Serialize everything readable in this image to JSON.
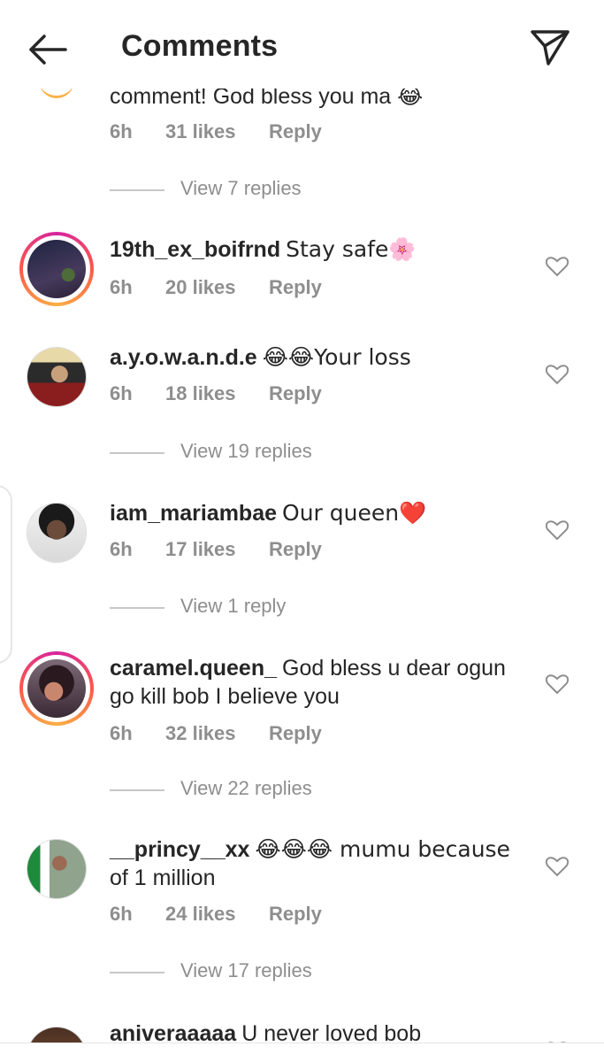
{
  "header": {
    "title": "Comments",
    "back_icon": "arrow-left-icon",
    "send_icon": "paper-plane-icon"
  },
  "top_partial": {
    "text": "comment! God bless you ma 😂",
    "time": "6h",
    "likes": "31 likes",
    "reply": "Reply",
    "view_replies": "View 7 replies"
  },
  "comments": [
    {
      "username": "19th_ex_boifrnd",
      "text": "Stay safe🌸",
      "time": "6h",
      "likes": "20 likes",
      "reply": "Reply",
      "story_ring": true
    },
    {
      "username": "a.y.o.w.a.n.d.e",
      "text": "😂😂Your loss",
      "time": "6h",
      "likes": "18 likes",
      "reply": "Reply",
      "view_replies": "View 19 replies"
    },
    {
      "username": "iam_mariambae",
      "text": "Our queen❤️",
      "time": "6h",
      "likes": "17 likes",
      "reply": "Reply",
      "view_replies": "View 1 reply"
    },
    {
      "username": "caramel.queen_",
      "text": "God bless u dear ogun",
      "text_line2": "go kill bob I believe you",
      "time": "6h",
      "likes": "32 likes",
      "reply": "Reply",
      "view_replies": "View 22 replies",
      "story_ring": true
    },
    {
      "username": "__princy__xx",
      "text": "😂😂😂 mumu because",
      "text_line2": "of 1 million",
      "time": "6h",
      "likes": "24 likes",
      "reply": "Reply",
      "view_replies": "View 17 replies"
    },
    {
      "username": "aniveraaaaa",
      "text": "U never loved bob"
    }
  ]
}
